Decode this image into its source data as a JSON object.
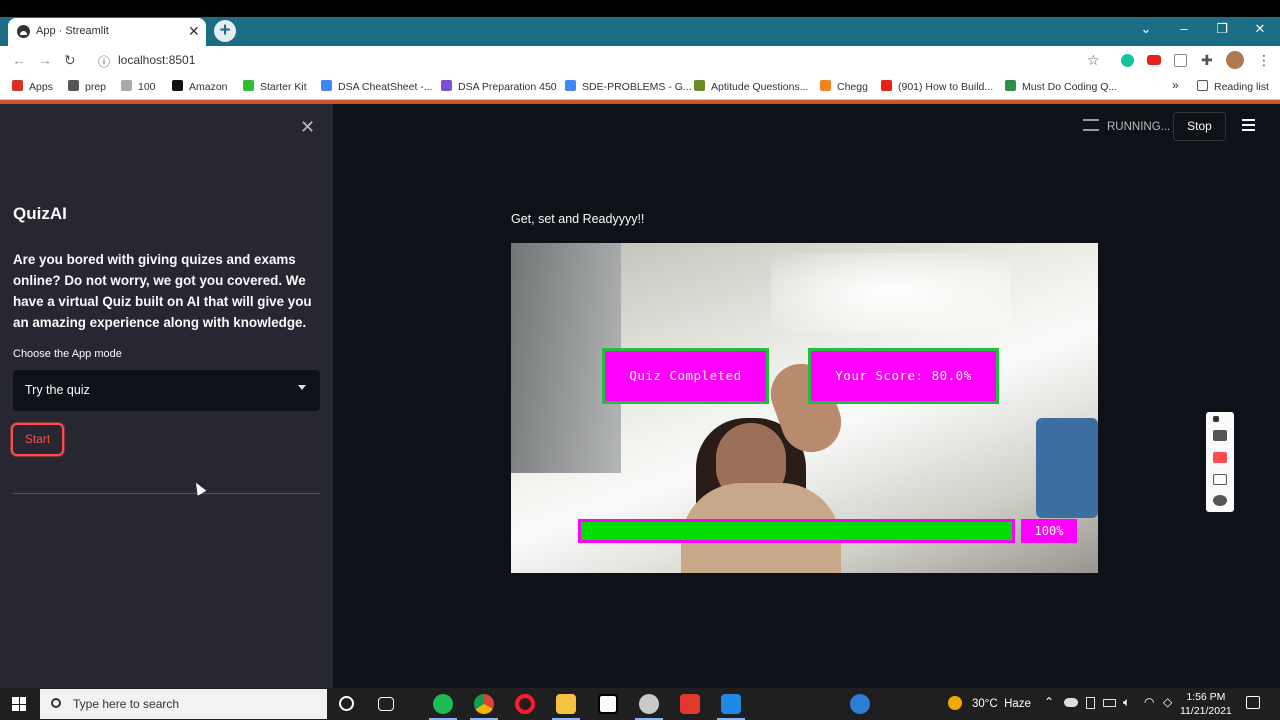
{
  "browser": {
    "tab_title": "App · Streamlit",
    "url": "localhost:8501",
    "bookmarks": [
      "Apps",
      "prep",
      "100",
      "Amazon",
      "Starter Kit",
      "DSA CheatSheet -...",
      "DSA Preparation 450",
      "SDE-PROBLEMS - G...",
      "Aptitude Questions...",
      "Chegg",
      "(901) How to Build...",
      "Must Do Coding Q..."
    ],
    "more_bookmarks": "»",
    "reading_list": "Reading list"
  },
  "sidebar": {
    "title": "QuizAI",
    "description": "Are you bored with giving quizes and exams online? Do not worry, we got you covered. We have a virtual Quiz built on AI that will give you an amazing experience along with knowledge.",
    "mode_label": "Choose the App mode",
    "mode_value": "Try the quiz",
    "start_label": "Start"
  },
  "header": {
    "status": "RUNNING...",
    "stop_label": "Stop"
  },
  "main": {
    "heading": "Get, set and Readyyyy!!",
    "quiz_status": "Quiz Completed",
    "score": "Your Score: 80.0%",
    "progress_label": "100%",
    "progress_fraction": 1.0
  },
  "taskbar": {
    "search_placeholder": "Type here to search",
    "temperature": "30°C",
    "weather": "Haze",
    "time": "1:56 PM",
    "date": "11/21/2021"
  },
  "colors": {
    "sidebar_bg": "#262730",
    "main_bg": "#0e1117",
    "accent_red": "#ff4b4b",
    "overlay_magenta": "#ff00ff",
    "overlay_green": "#00dd00"
  }
}
